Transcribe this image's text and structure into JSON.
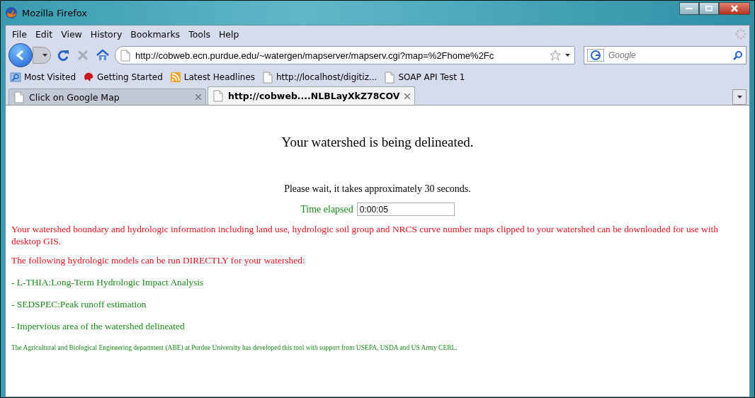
{
  "window": {
    "title": "Mozilla Firefox"
  },
  "menu": [
    "File",
    "Edit",
    "View",
    "History",
    "Bookmarks",
    "Tools",
    "Help"
  ],
  "address_bar": {
    "value": "http://cobweb.ecn.purdue.edu/~watergen/mapserver/mapserv.cgi?map=%2Fhome%2Fc"
  },
  "search": {
    "placeholder": "Google"
  },
  "bookmarks": [
    {
      "kind": "smart",
      "label": "Most Visited"
    },
    {
      "kind": "started",
      "label": "Getting Started"
    },
    {
      "kind": "feed",
      "label": "Latest Headlines"
    },
    {
      "kind": "page",
      "label": "http://localhost/digitiz..."
    },
    {
      "kind": "page",
      "label": "SOAP API Test 1"
    }
  ],
  "tabs": [
    {
      "label": "Click on Google Map",
      "selected": false
    },
    {
      "label": "http://cobweb....NLBLayXkZ78COV",
      "selected": true
    }
  ],
  "page": {
    "heading": "Your watershed is being delineated.",
    "wait_note": "Please wait, it takes approximately 30 seconds.",
    "timer": {
      "label": "Time elapsed",
      "value": "0:00:05"
    },
    "paragraphs": [
      {
        "kind": "alert",
        "text": "Your watershed boundary and hydrologic information including land use, hydrologic soil group and NRCS curve number maps clipped to your watershed can be downloaded for use with desktop GIS."
      },
      {
        "kind": "alert",
        "text": "The following hydrologic models can be run DIRECTLY for your watershed:"
      },
      {
        "kind": "model",
        "text": "- L-THIA:Long-Term Hydrologic Impact Analysis"
      },
      {
        "kind": "model",
        "text": "- SEDSPEC:Peak runoff estimation"
      },
      {
        "kind": "model",
        "text": "- Impervious area of the watershed delineated"
      },
      {
        "kind": "credit",
        "text": "The Agricultural and Biological Engineering department (ABE) at Purdue University has developed this tool with support from USEPA, USDA and US Army CERL."
      }
    ]
  }
}
